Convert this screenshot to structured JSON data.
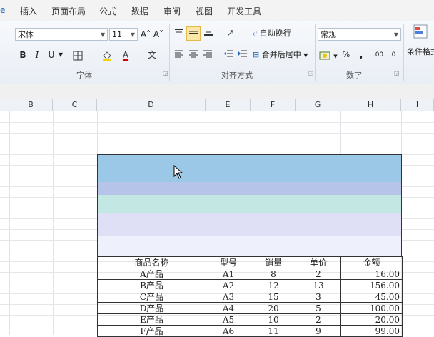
{
  "menu": {
    "items": [
      "插入",
      "页面布局",
      "公式",
      "数据",
      "审阅",
      "视图",
      "开发工具"
    ]
  },
  "ribbon": {
    "font_name": "宋体",
    "font_size": "11",
    "grow_font": "A˄",
    "shrink_font": "A˅",
    "bold": "B",
    "italic": "I",
    "underline": "U",
    "font_color_glyph": "A",
    "phonetic": "文",
    "wrap_text": "自动换行",
    "merge_center": "合并后居中",
    "number_format": "常规",
    "percent": "%",
    "comma": ",",
    "inc_decimal": ".00",
    "dec_decimal": ".0",
    "cond_format": "条件格式",
    "group_font": "字体",
    "group_align": "对齐方式",
    "group_number": "数字",
    "accent": "#fde7a8"
  },
  "columns": [
    "B",
    "C",
    "D",
    "E",
    "F",
    "G",
    "H",
    "I"
  ],
  "banner_colors": [
    "#9cc8e8",
    "#b7c4ea",
    "#c3e8e3",
    "#dfe0f6",
    "#eef0fc"
  ],
  "table": {
    "headers": [
      "商品名称",
      "型号",
      "销量",
      "单价",
      "金额"
    ],
    "rows": [
      [
        "A产品",
        "A1",
        "8",
        "2",
        "16.00"
      ],
      [
        "B产品",
        "A2",
        "12",
        "13",
        "156.00"
      ],
      [
        "C产品",
        "A3",
        "15",
        "3",
        "45.00"
      ],
      [
        "D产品",
        "A4",
        "20",
        "5",
        "100.00"
      ],
      [
        "E产品",
        "A5",
        "10",
        "2",
        "20.00"
      ],
      [
        "F产品",
        "A6",
        "11",
        "9",
        "99.00"
      ]
    ]
  }
}
